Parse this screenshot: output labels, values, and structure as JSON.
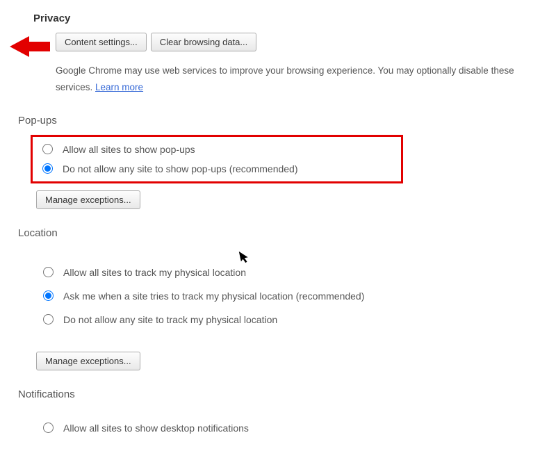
{
  "privacy": {
    "title": "Privacy",
    "buttons": {
      "content_settings": "Content settings...",
      "clear_browsing_data": "Clear browsing data..."
    },
    "description_pre": "Google Chrome may use web services to improve your browsing experience. You may optionally disable these services. ",
    "learn_more": "Learn more"
  },
  "popups": {
    "title": "Pop-ups",
    "options": {
      "allow_all": "Allow all sites to show pop-ups",
      "block_all": "Do not allow any site to show pop-ups (recommended)"
    },
    "selected": "block_all",
    "manage_exceptions": "Manage exceptions..."
  },
  "location": {
    "title": "Location",
    "options": {
      "allow_all": "Allow all sites to track my physical location",
      "ask": "Ask me when a site tries to track my physical location (recommended)",
      "deny_all": "Do not allow any site to track my physical location"
    },
    "selected": "ask",
    "manage_exceptions": "Manage exceptions..."
  },
  "notifications": {
    "title": "Notifications",
    "options": {
      "allow_all": "Allow all sites to show desktop notifications"
    }
  }
}
